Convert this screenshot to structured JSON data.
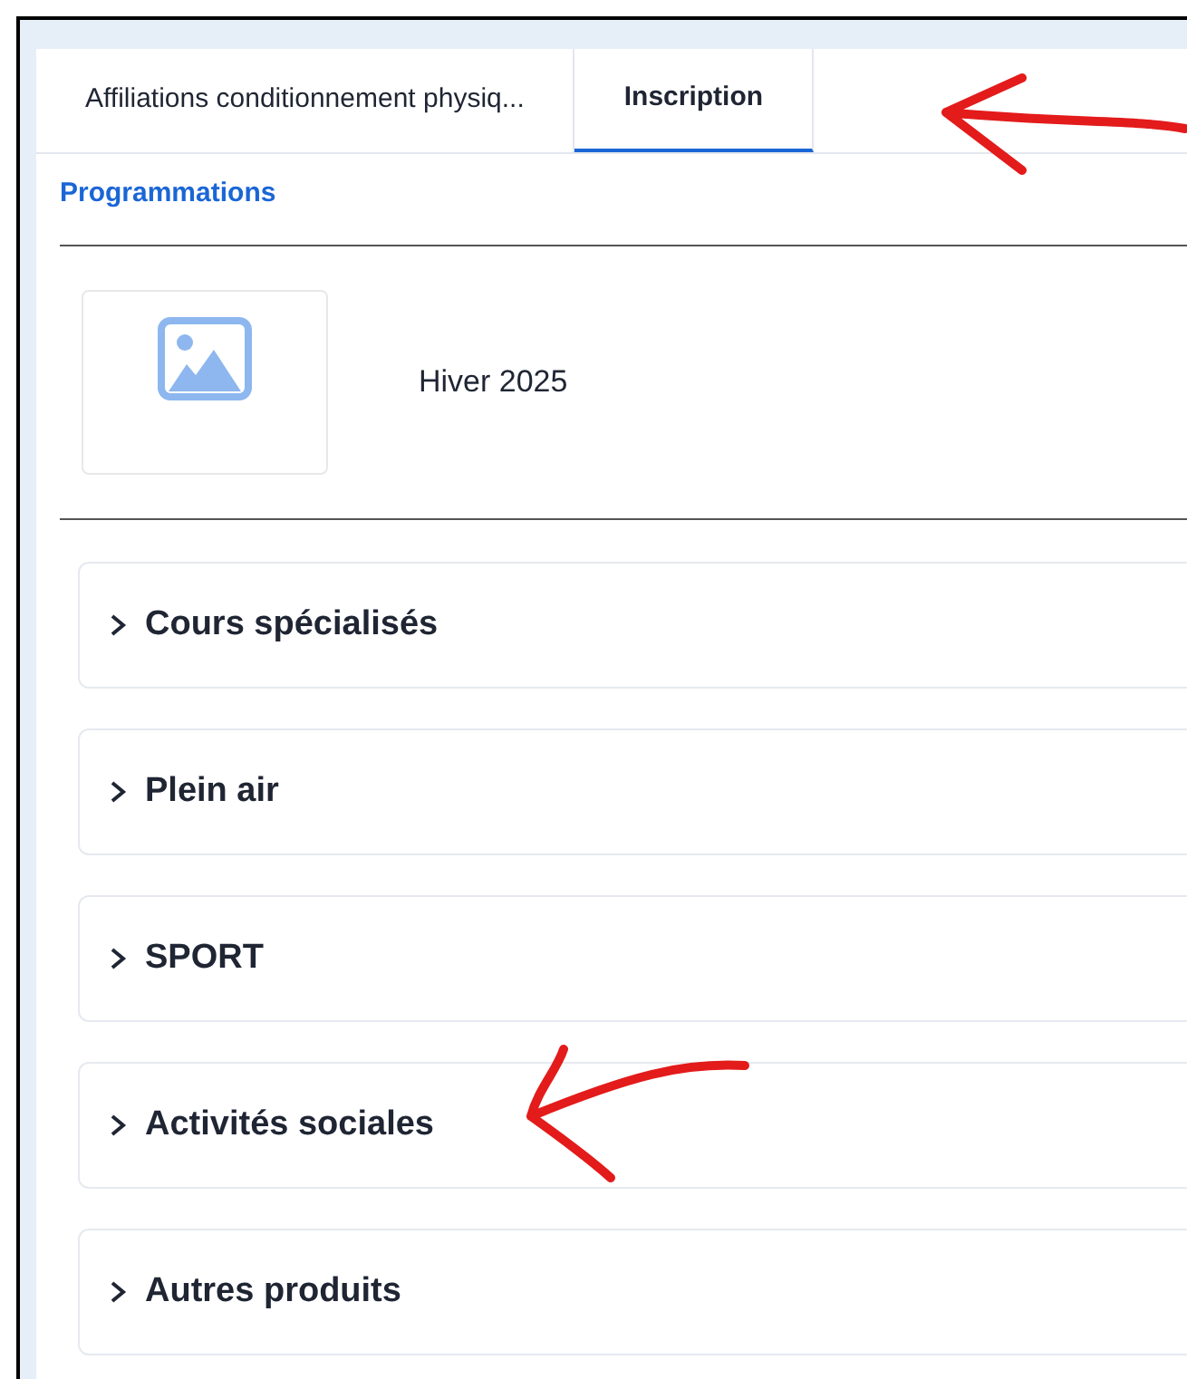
{
  "tabs": [
    {
      "label": "Affiliations conditionnement physiq...",
      "selected": false
    },
    {
      "label": "Inscription",
      "selected": true
    }
  ],
  "section_link": "Programmations",
  "program": {
    "title": "Hiver 2025"
  },
  "categories": [
    {
      "label": "Cours spécialisés",
      "expanded": false
    },
    {
      "label": "Plein air",
      "expanded": false
    },
    {
      "label": "SPORT",
      "expanded": false
    },
    {
      "label": "Activités sociales",
      "expanded": false
    },
    {
      "label": "Autres produits",
      "expanded": false
    }
  ]
}
